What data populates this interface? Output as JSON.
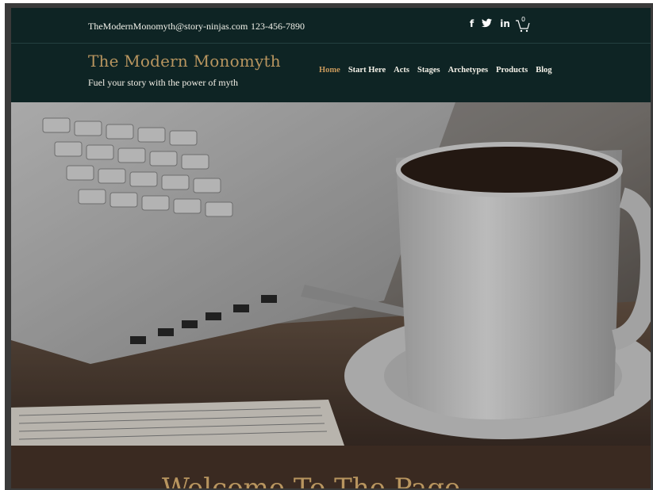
{
  "topbar": {
    "email": "TheModernMonomyth@story-ninjas.com",
    "phone": "123-456-7890",
    "social_icons": [
      "facebook-icon",
      "twitter-icon",
      "linkedin-icon"
    ],
    "social_glyphs": [
      "f",
      "❤",
      "in"
    ],
    "cart_count": "0"
  },
  "header": {
    "brand": "The Modern Monomyth",
    "tagline": "Fuel your story with the power of myth"
  },
  "nav": {
    "items": [
      "Home",
      "Start Here",
      "Acts",
      "Stages",
      "Archetypes",
      "Products",
      "Blog"
    ],
    "active": "Home"
  },
  "welcome": {
    "title": "Welcome To The Page"
  },
  "colors": {
    "dark_teal": "#0e2424",
    "accent_gold": "#b8955f",
    "brown": "#3a2a21"
  }
}
